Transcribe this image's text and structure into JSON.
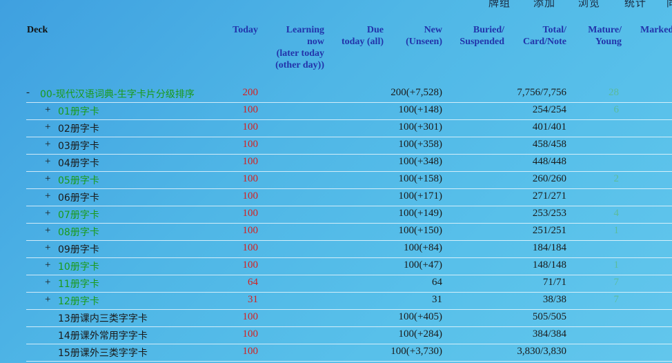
{
  "menu": [
    "牌组",
    "添加",
    "浏览",
    "统计",
    "同步"
  ],
  "headers": {
    "deck": "Deck",
    "today": "Today",
    "learning": "Learning\nnow\n(later today\n(other day))",
    "due": "Due\ntoday (all)",
    "new": "New\n(Unseen)",
    "buried": "Buried/\nSuspended",
    "total": "Total/\nCard/Note",
    "mature": "Mature/\nYoung",
    "marked": "Marked"
  },
  "colors": {
    "today": "#d42020",
    "deck_green": "#1a9a1a",
    "header": "#2233aa"
  },
  "rows": [
    {
      "exp": "-",
      "name": "00-现代汉语词典-生字卡片分级排序",
      "today": "200",
      "due": "200(+7,528)",
      "total": "7,756/7,756",
      "young": "28",
      "green": true
    },
    {
      "exp": "+",
      "name": "01册字卡",
      "today": "100",
      "due": "100(+148)",
      "total": "254/254",
      "young": "6",
      "green": true
    },
    {
      "exp": "+",
      "name": "02册字卡",
      "today": "100",
      "due": "100(+301)",
      "total": "401/401",
      "young": "",
      "green": false
    },
    {
      "exp": "+",
      "name": "03册字卡",
      "today": "100",
      "due": "100(+358)",
      "total": "458/458",
      "young": "",
      "green": false
    },
    {
      "exp": "+",
      "name": "04册字卡",
      "today": "100",
      "due": "100(+348)",
      "total": "448/448",
      "young": "",
      "green": false
    },
    {
      "exp": "+",
      "name": "05册字卡",
      "today": "100",
      "due": "100(+158)",
      "total": "260/260",
      "young": "2",
      "green": true
    },
    {
      "exp": "+",
      "name": "06册字卡",
      "today": "100",
      "due": "100(+171)",
      "total": "271/271",
      "young": "",
      "green": false
    },
    {
      "exp": "+",
      "name": "07册字卡",
      "today": "100",
      "due": "100(+149)",
      "total": "253/253",
      "young": "4",
      "green": true
    },
    {
      "exp": "+",
      "name": "08册字卡",
      "today": "100",
      "due": "100(+150)",
      "total": "251/251",
      "young": "1",
      "green": true
    },
    {
      "exp": "+",
      "name": "09册字卡",
      "today": "100",
      "due": "100(+84)",
      "total": "184/184",
      "young": "",
      "green": false
    },
    {
      "exp": "+",
      "name": "10册字卡",
      "today": "100",
      "due": "100(+47)",
      "total": "148/148",
      "young": "1",
      "green": true
    },
    {
      "exp": "+",
      "name": "11册字卡",
      "today": "64",
      "due": "64",
      "total": "71/71",
      "young": "7",
      "green": true
    },
    {
      "exp": "+",
      "name": "12册字卡",
      "today": "31",
      "due": "31",
      "total": "38/38",
      "young": "7",
      "green": true
    },
    {
      "exp": "",
      "name": "13册课内三类字字卡",
      "today": "100",
      "due": "100(+405)",
      "total": "505/505",
      "young": "",
      "green": false
    },
    {
      "exp": "",
      "name": "14册课外常用字字卡",
      "today": "100",
      "due": "100(+284)",
      "total": "384/384",
      "young": "",
      "green": false
    },
    {
      "exp": "",
      "name": "15册课外三类字字卡",
      "today": "100",
      "due": "100(+3,730)",
      "total": "3,830/3,830",
      "young": "",
      "green": false
    }
  ]
}
